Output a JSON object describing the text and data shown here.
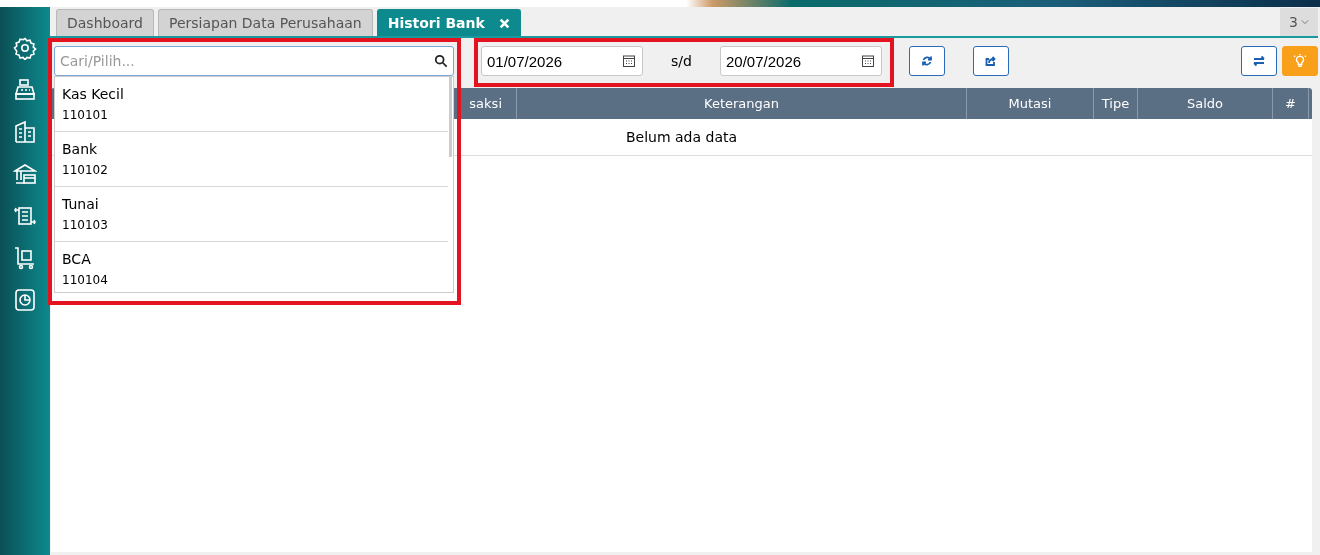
{
  "sidebar": {
    "items": [
      {
        "kind": "gear"
      },
      {
        "kind": "register"
      },
      {
        "kind": "building"
      },
      {
        "kind": "bank"
      },
      {
        "kind": "transfer"
      },
      {
        "kind": "cart"
      },
      {
        "kind": "report"
      }
    ]
  },
  "tabs": [
    {
      "label": "Dashboard",
      "selected": false,
      "closable": false
    },
    {
      "label": "Persiapan Data Perusahaan",
      "selected": false,
      "closable": false
    },
    {
      "label": "Histori Bank",
      "selected": true,
      "closable": true
    }
  ],
  "tab_count": "3",
  "account_picker": {
    "placeholder": "Cari/Pilih...",
    "options": [
      {
        "name": "Kas Kecil",
        "code": "110101"
      },
      {
        "name": "Bank",
        "code": "110102"
      },
      {
        "name": "Tunai",
        "code": "110103"
      },
      {
        "name": "BCA",
        "code": "110104"
      }
    ]
  },
  "date_from": "01/07/2026",
  "range_separator": "s/d",
  "date_to": "20/07/2026",
  "table": {
    "columns": [
      "saksi",
      "Keterangan",
      "Mutasi",
      "Tipe",
      "Saldo",
      "#"
    ],
    "empty_message": "Belum ada data"
  }
}
